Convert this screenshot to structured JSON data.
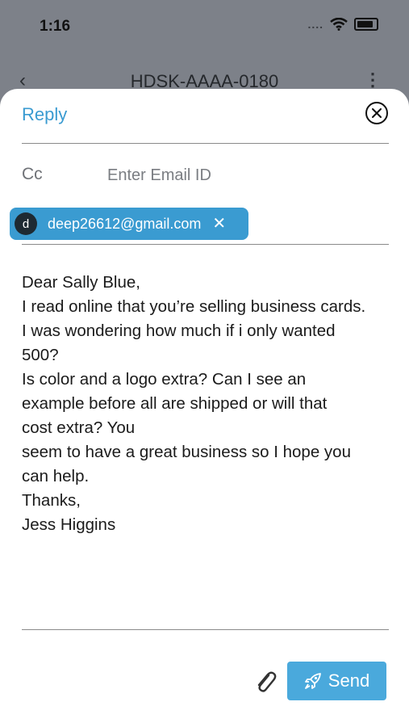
{
  "status_bar": {
    "time": "1:16",
    "signal": "....",
    "wifi_icon": "wifi-icon",
    "battery_icon": "battery-icon"
  },
  "appbar": {
    "title": "HDSK-AAAA-0180",
    "back_icon": "back-chevron-icon",
    "menu_icon": "kebab-menu-icon"
  },
  "reply_sheet": {
    "title": "Reply",
    "close_icon": "close-circle-icon",
    "cc": {
      "label": "Cc",
      "placeholder": "Enter Email ID",
      "value": ""
    },
    "recipient_chip": {
      "avatar_letter": "d",
      "email": "deep26612@gmail.com",
      "remove_glyph": "✕"
    },
    "body_lines": [
      "Dear Sally Blue,",
      "I read online that you’re selling business cards.",
      "I was wondering how much if i only wanted",
      "500?",
      "Is color and a logo extra? Can I see an",
      "example before all are shipped or will that",
      "cost extra? You",
      "seem to have a great business so I hope you",
      "can help.",
      "Thanks,",
      "Jess Higgins"
    ],
    "attach_icon": "paperclip-icon",
    "send_label": "Send",
    "send_icon": "rocket-icon"
  },
  "colors": {
    "accent": "#3a9bd1",
    "send_button": "#4aa9dc",
    "backdrop": "#7d8189"
  }
}
